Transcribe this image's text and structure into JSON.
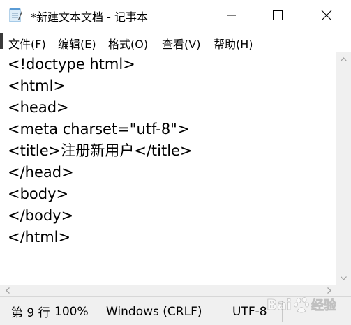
{
  "window": {
    "title": "*新建文本文档 - 记事本"
  },
  "menu": {
    "items": [
      "文件(F)",
      "编辑(E)",
      "格式(O)",
      "查看(V)",
      "帮助(H)"
    ]
  },
  "editor": {
    "lines": [
      "<!doctype html>",
      "<html>",
      "<head>",
      "<meta charset=\"utf-8\">",
      "<title>注册新用户</title>",
      "</head>",
      "<body>",
      "</body>",
      "</html>"
    ]
  },
  "status": {
    "position": "第 9 行",
    "zoom": "100%",
    "line_ending": "Windows (CRLF)",
    "encoding": "UTF-8"
  },
  "watermark": {
    "text": "Bai 经验"
  },
  "colors": {
    "scrollbar_bg": "#f0f0f0",
    "statusbar_bg": "#f0f0f0",
    "arrow": "#a0a0a0"
  },
  "icons": {
    "app": "notepad-icon",
    "minimize": "minimize-icon",
    "maximize": "maximize-icon",
    "close": "close-icon"
  }
}
